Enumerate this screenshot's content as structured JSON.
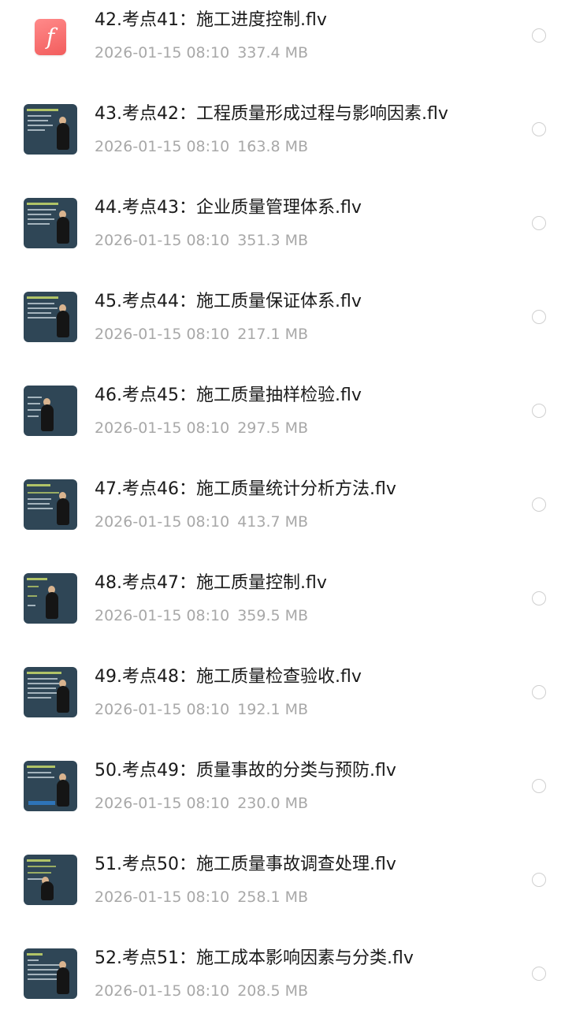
{
  "files": [
    {
      "name": "42.考点41：施工进度控制.flv",
      "date": "2026-01-15 08:10",
      "size": "337.4 MB",
      "icon": "flash-file-icon"
    },
    {
      "name": "43.考点42：工程质量形成过程与影响因素.flv",
      "date": "2026-01-15 08:10",
      "size": "163.8 MB",
      "icon": "video-thumbnail"
    },
    {
      "name": "44.考点43：企业质量管理体系.flv",
      "date": "2026-01-15 08:10",
      "size": "351.3 MB",
      "icon": "video-thumbnail"
    },
    {
      "name": "45.考点44：施工质量保证体系.flv",
      "date": "2026-01-15 08:10",
      "size": "217.1 MB",
      "icon": "video-thumbnail"
    },
    {
      "name": "46.考点45：施工质量抽样检验.flv",
      "date": "2026-01-15 08:10",
      "size": "297.5 MB",
      "icon": "video-thumbnail"
    },
    {
      "name": "47.考点46：施工质量统计分析方法.flv",
      "date": "2026-01-15 08:10",
      "size": "413.7 MB",
      "icon": "video-thumbnail"
    },
    {
      "name": "48.考点47：施工质量控制.flv",
      "date": "2026-01-15 08:10",
      "size": "359.5 MB",
      "icon": "video-thumbnail"
    },
    {
      "name": "49.考点48：施工质量检查验收.flv",
      "date": "2026-01-15 08:10",
      "size": "192.1 MB",
      "icon": "video-thumbnail"
    },
    {
      "name": "50.考点49：质量事故的分类与预防.flv",
      "date": "2026-01-15 08:10",
      "size": "230.0 MB",
      "icon": "video-thumbnail"
    },
    {
      "name": "51.考点50：施工质量事故调查处理.flv",
      "date": "2026-01-15 08:10",
      "size": "258.1 MB",
      "icon": "video-thumbnail"
    },
    {
      "name": "52.考点51：施工成本影响因素与分类.flv",
      "date": "2026-01-15 08:10",
      "size": "208.5 MB",
      "icon": "video-thumbnail"
    }
  ]
}
